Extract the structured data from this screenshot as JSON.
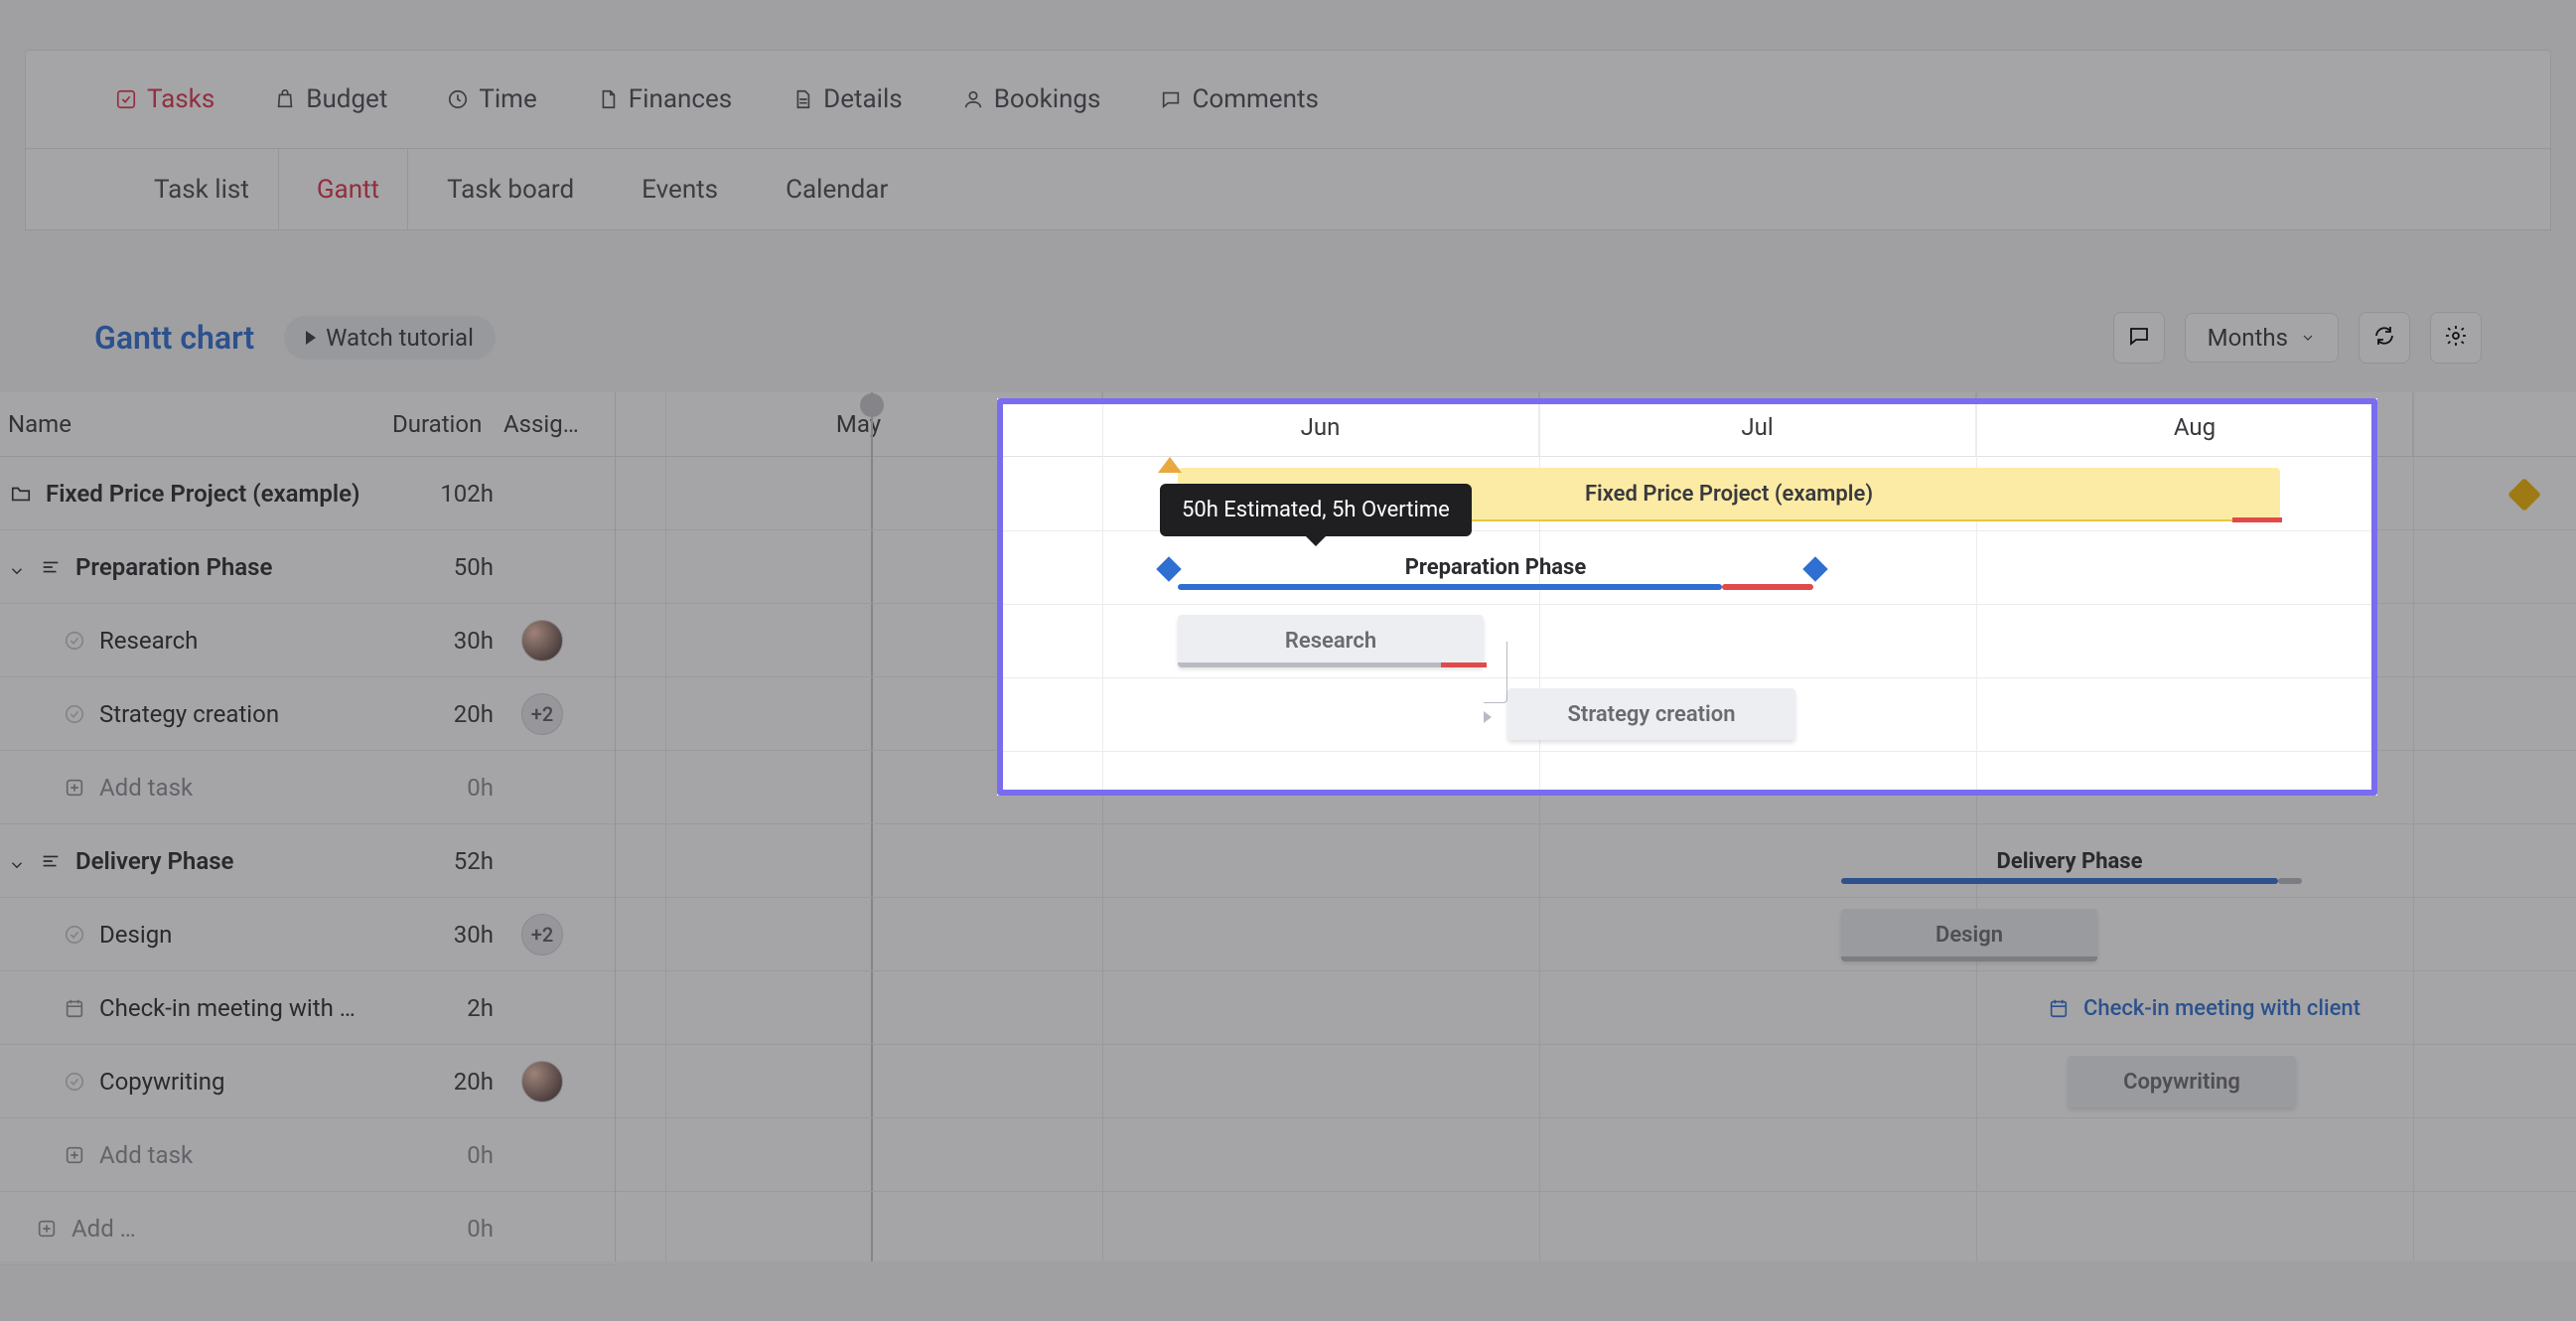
{
  "tabs": {
    "tasks": "Tasks",
    "budget": "Budget",
    "time": "Time",
    "finances": "Finances",
    "details": "Details",
    "bookings": "Bookings",
    "comments": "Comments"
  },
  "subtabs": {
    "tasklist": "Task list",
    "gantt": "Gantt",
    "taskboard": "Task board",
    "events": "Events",
    "calendar": "Calendar"
  },
  "header": {
    "title": "Gantt chart",
    "watch": "Watch tutorial",
    "scale": "Months"
  },
  "columns": {
    "name": "Name",
    "duration": "Duration",
    "assignee": "Assig…"
  },
  "tooltip": "50h Estimated, 5h Overtime",
  "months": [
    "May",
    "Jun",
    "Jul",
    "Aug"
  ],
  "rows": {
    "project": {
      "name": "Fixed Price Project (example)",
      "dur": "102h"
    },
    "phase1": {
      "name": "Preparation Phase",
      "dur": "50h"
    },
    "research": {
      "name": "Research",
      "dur": "30h"
    },
    "strategy": {
      "name": "Strategy creation",
      "dur": "20h",
      "badge": "+2"
    },
    "add1": {
      "name": "Add task",
      "dur": "0h"
    },
    "phase2": {
      "name": "Delivery Phase",
      "dur": "52h"
    },
    "design": {
      "name": "Design",
      "dur": "30h",
      "badge": "+2"
    },
    "checkin": {
      "name": "Check-in meeting with …",
      "dur": "2h"
    },
    "copy": {
      "name": "Copywriting",
      "dur": "20h"
    },
    "add2": {
      "name": "Add task",
      "dur": "0h"
    },
    "addlast": {
      "name": "Add …",
      "dur": "0h"
    }
  },
  "bars": {
    "project": "Fixed Price Project (example)",
    "phase1": "Preparation Phase",
    "research": "Research",
    "strategy": "Strategy creation",
    "phase2": "Delivery Phase",
    "design": "Design",
    "checkin": "Check-in meeting with client",
    "copy": "Copywriting"
  }
}
